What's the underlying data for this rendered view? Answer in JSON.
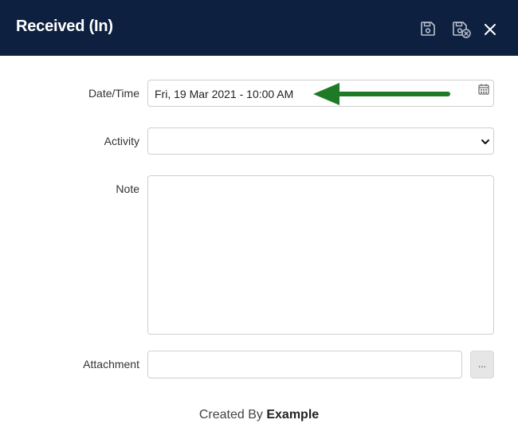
{
  "dialog": {
    "title": "Received (In)",
    "save_icon": "save-icon",
    "save_close_icon": "save-and-close-icon",
    "close_icon": "close-icon"
  },
  "form": {
    "datetime": {
      "label": "Date/Time",
      "value": "Fri, 19 Mar 2021 - 10:00 AM",
      "icon": "calendar-icon"
    },
    "activity": {
      "label": "Activity",
      "value": "",
      "icon": "chevron-down-icon"
    },
    "note": {
      "label": "Note",
      "value": ""
    },
    "attachment": {
      "label": "Attachment",
      "value": "",
      "browse_label": "..."
    }
  },
  "footer": {
    "prefix": "Created By",
    "creator": "Example"
  },
  "annotation": {
    "icon": "arrow-left-icon",
    "color": "#1e7a24"
  },
  "colors": {
    "header_bg": "#0d2040",
    "header_icon": "#b9c2cf"
  }
}
